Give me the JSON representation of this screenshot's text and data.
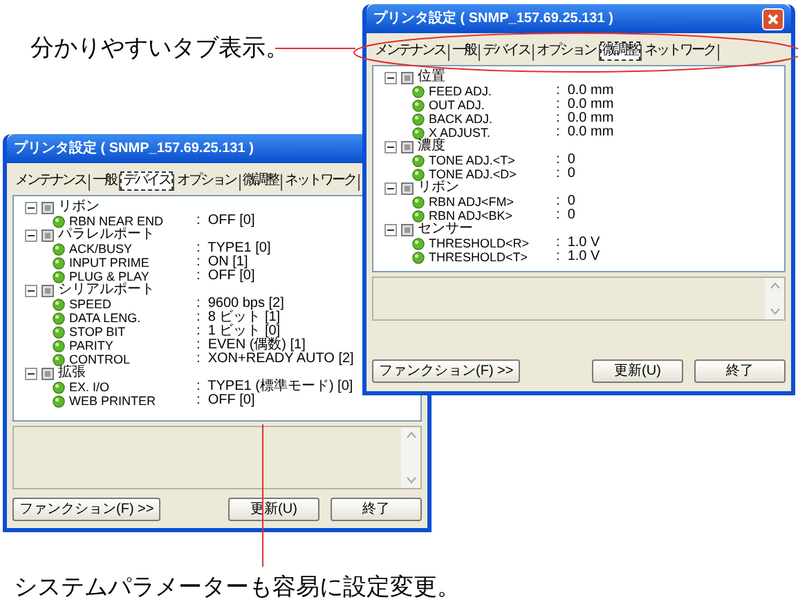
{
  "annotations": [
    {
      "text": "分かりやすいタブ表示。"
    },
    {
      "text": "システムパラメーターも容易に設定変更。"
    }
  ],
  "windows": [
    {
      "title": "プリンタ設定 ( SNMP_157.69.25.131 )",
      "tabs": [
        {
          "label": "メンテナンス",
          "selected": false
        },
        {
          "label": "一般",
          "selected": false
        },
        {
          "label": "デバイス",
          "selected": true
        },
        {
          "label": "オプション",
          "selected": false
        },
        {
          "label": "微調整",
          "selected": false
        },
        {
          "label": "ネットワーク",
          "selected": false
        }
      ],
      "tree": [
        {
          "label": "リボン",
          "expanded": true,
          "children": [
            {
              "label": "RBN NEAR END",
              "value": ":  OFF [0]"
            }
          ]
        },
        {
          "label": "パラレルポート",
          "expanded": true,
          "children": [
            {
              "label": "ACK/BUSY",
              "value": ":  TYPE1 [0]"
            },
            {
              "label": "INPUT PRIME",
              "value": ":  ON [1]"
            },
            {
              "label": "PLUG & PLAY",
              "value": ":  OFF [0]"
            }
          ]
        },
        {
          "label": "シリアルポート",
          "expanded": true,
          "children": [
            {
              "label": "SPEED",
              "value": ":  9600 bps [2]"
            },
            {
              "label": "DATA LENG.",
              "value": ":  8 ビット [1]"
            },
            {
              "label": "STOP BIT",
              "value": ":  1 ビット [0]"
            },
            {
              "label": "PARITY",
              "value": ":  EVEN (偶数) [1]"
            },
            {
              "label": "CONTROL",
              "value": ":  XON+READY AUTO [2]"
            }
          ]
        },
        {
          "label": "拡張",
          "expanded": true,
          "children": [
            {
              "label": "EX. I/O",
              "value": ":  TYPE1 (標準モード) [0]"
            },
            {
              "label": "WEB PRINTER",
              "value": ":  OFF [0]"
            }
          ]
        }
      ],
      "buttons": [
        "ファンクション(F) >>",
        "更新(U)",
        "終了"
      ]
    },
    {
      "title": "プリンタ設定 ( SNMP_157.69.25.131 )",
      "close_button": true,
      "tabs": [
        {
          "label": "メンテナンス",
          "selected": false
        },
        {
          "label": "一般",
          "selected": false
        },
        {
          "label": "デバイス",
          "selected": false
        },
        {
          "label": "オプション",
          "selected": false
        },
        {
          "label": "微調整",
          "selected": true
        },
        {
          "label": "ネットワーク",
          "selected": false
        }
      ],
      "tree": [
        {
          "label": "位置",
          "expanded": true,
          "children": [
            {
              "label": "FEED ADJ.",
              "value": ":  0.0 mm"
            },
            {
              "label": "OUT ADJ.",
              "value": ":  0.0 mm"
            },
            {
              "label": "BACK ADJ.",
              "value": ":  0.0 mm"
            },
            {
              "label": "X ADJUST.",
              "value": ":  0.0 mm"
            }
          ]
        },
        {
          "label": "濃度",
          "expanded": true,
          "children": [
            {
              "label": "TONE ADJ.<T>",
              "value": ":  0"
            },
            {
              "label": "TONE ADJ.<D>",
              "value": ":  0"
            }
          ]
        },
        {
          "label": "リボン",
          "expanded": true,
          "children": [
            {
              "label": "RBN ADJ<FM>",
              "value": ":  0"
            },
            {
              "label": "RBN ADJ<BK>",
              "value": ":  0"
            }
          ]
        },
        {
          "label": "センサー",
          "expanded": true,
          "children": [
            {
              "label": "THRESHOLD<R>",
              "value": ":  1.0 V"
            },
            {
              "label": "THRESHOLD<T>",
              "value": ":  1.0 V"
            }
          ]
        }
      ],
      "buttons": [
        "ファンクション(F) >>",
        "更新(U)",
        "終了"
      ]
    }
  ]
}
